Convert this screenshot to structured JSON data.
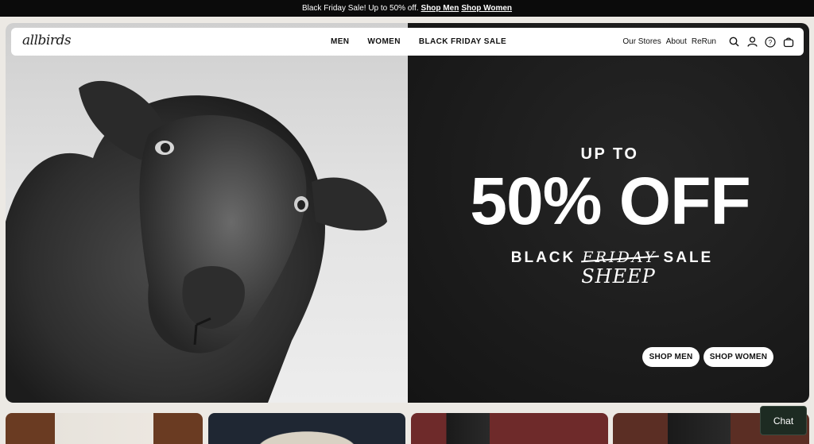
{
  "announcement": {
    "text": "Black Friday Sale! Up to 50% off.",
    "shop_men": "Shop Men",
    "shop_women": "Shop Women"
  },
  "nav": {
    "logo": "allbirds",
    "center": [
      "MEN",
      "WOMEN",
      "BLACK FRIDAY SALE"
    ],
    "right_links": [
      "Our Stores",
      "About",
      "ReRun"
    ],
    "icons": [
      "search-icon",
      "account-icon",
      "help-icon",
      "cart-icon"
    ]
  },
  "hero": {
    "up_to": "UP TO",
    "discount": "50% OFF",
    "black": "BLACK",
    "friday": "FRIDAY",
    "sale": "SALE",
    "sheep": "SHEEP",
    "cta_men": "SHOP MEN",
    "cta_women": "SHOP WOMEN"
  },
  "chat": {
    "label": "Chat"
  },
  "colors": {
    "announcement_bg": "#0b0b0b",
    "hero_right_bg": "#1b1b1b",
    "chat_bg": "#1d2b22"
  }
}
